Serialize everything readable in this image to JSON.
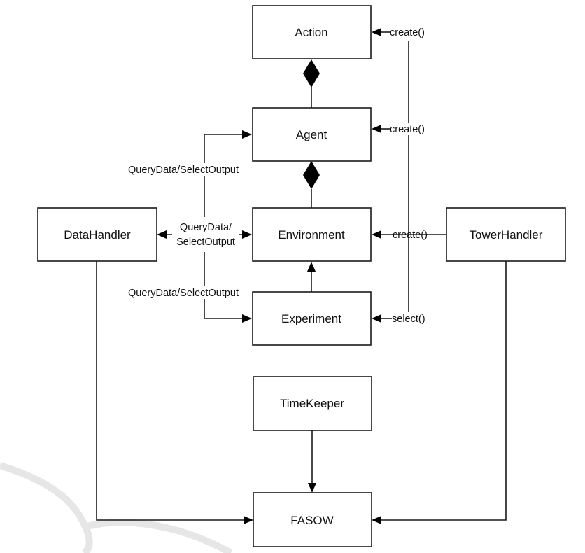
{
  "diagram": {
    "nodes": {
      "action": "Action",
      "agent": "Agent",
      "environment": "Environment",
      "experiment": "Experiment",
      "datahandler": "DataHandler",
      "towerhandler": "TowerHandler",
      "timekeeper": "TimeKeeper",
      "fasow": "FASOW"
    },
    "edges": {
      "towerhandler_action": "create()",
      "towerhandler_agent": "create()",
      "towerhandler_environment": "create()",
      "towerhandler_experiment": "select()",
      "datahandler_agent": "QueryData/SelectOutput",
      "datahandler_environment_line1": "QueryData/",
      "datahandler_environment_line2": "SelectOutput",
      "datahandler_experiment": "QueryData/SelectOutput"
    },
    "relations": [
      {
        "from": "Agent",
        "to": "Action",
        "type": "composition"
      },
      {
        "from": "Environment",
        "to": "Agent",
        "type": "composition"
      },
      {
        "from": "Experiment",
        "to": "Environment",
        "type": "association"
      },
      {
        "from": "TowerHandler",
        "to": "Action",
        "label": "create()"
      },
      {
        "from": "TowerHandler",
        "to": "Agent",
        "label": "create()"
      },
      {
        "from": "TowerHandler",
        "to": "Environment",
        "label": "create()"
      },
      {
        "from": "TowerHandler",
        "to": "Experiment",
        "label": "select()"
      },
      {
        "from": "DataHandler",
        "to": "Agent",
        "label": "QueryData/SelectOutput"
      },
      {
        "from": "DataHandler",
        "to": "Environment",
        "label": "QueryData/SelectOutput"
      },
      {
        "from": "DataHandler",
        "to": "Experiment",
        "label": "QueryData/SelectOutput"
      },
      {
        "from": "TimeKeeper",
        "to": "FASOW"
      },
      {
        "from": "DataHandler",
        "to": "FASOW"
      },
      {
        "from": "TowerHandler",
        "to": "FASOW"
      }
    ]
  }
}
